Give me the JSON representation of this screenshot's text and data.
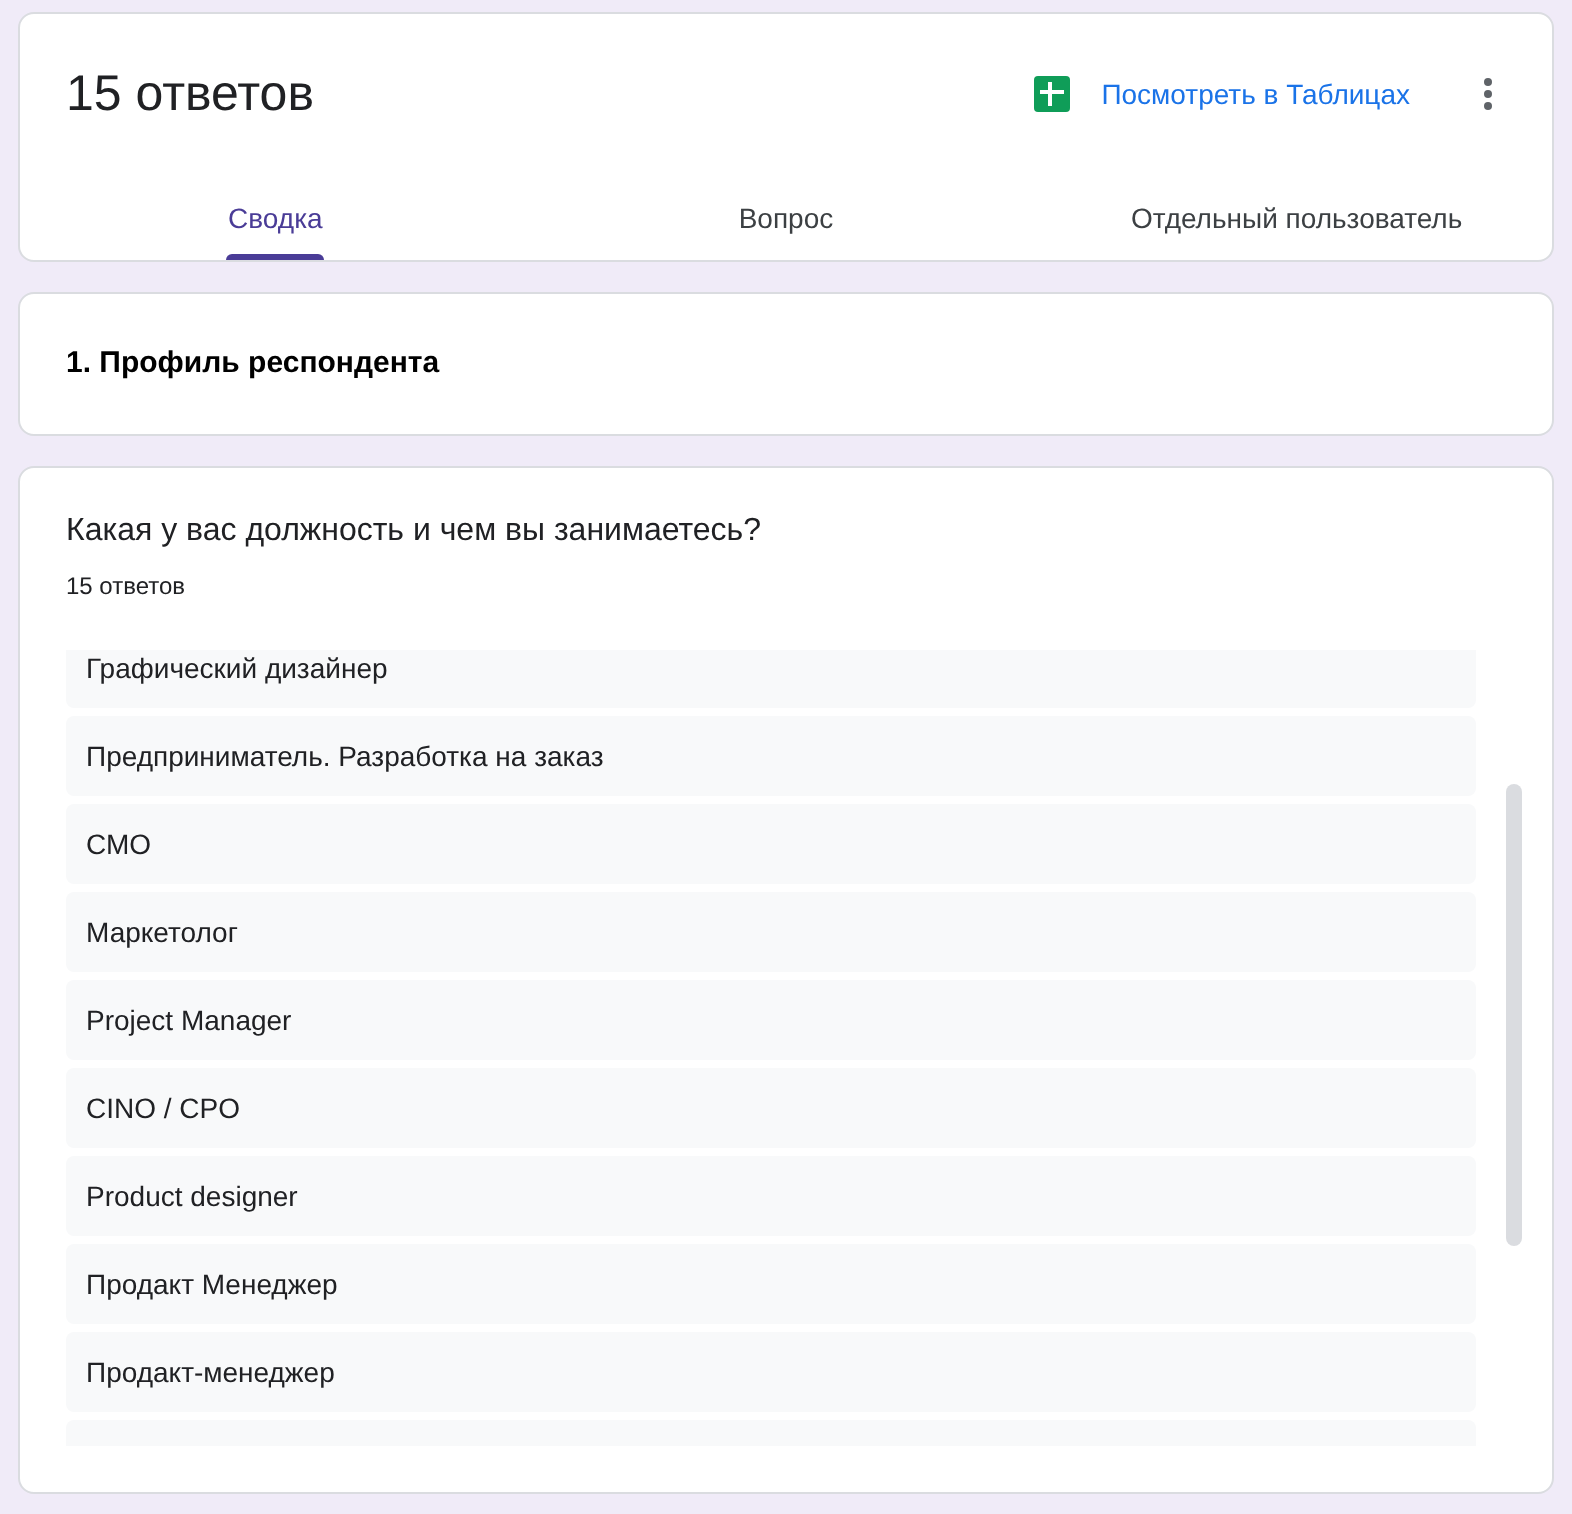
{
  "header": {
    "title": "15 ответов",
    "sheets_link": "Посмотреть в Таблицах"
  },
  "tabs": [
    {
      "label": "Сводка",
      "selected": true
    },
    {
      "label": "Вопрос",
      "selected": false
    },
    {
      "label": "Отдельный пользователь",
      "selected": false
    }
  ],
  "section": {
    "title": "1. Профиль респондента"
  },
  "question": {
    "text": "Какая у вас должность и чем вы занимаетесь?",
    "count": "15 ответов",
    "responses": [
      "Графический дизайнер",
      "Предприниматель. Разработка на заказ",
      "СМО",
      "Маркетолог",
      "Project Manager",
      "CINO / CPO",
      "Product designer",
      "Продакт Менеджер",
      "Продакт-менеджер"
    ]
  }
}
